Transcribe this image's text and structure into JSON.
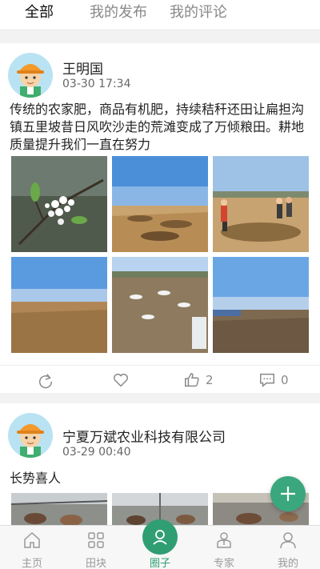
{
  "tabs": [
    {
      "label": "全部",
      "active": true
    },
    {
      "label": "我的发布",
      "active": false
    },
    {
      "label": "我的评论",
      "active": false
    }
  ],
  "posts": [
    {
      "author": "王明国",
      "time": "03-30 17:34",
      "content": "传统的农家肥，商品有机肥，持续秸秆还田让扁担沟镇五里坡昔日风吹沙走的荒滩变成了万倾粮田。耕地质量提升我们一直在努力",
      "images": [
        "pear-blossom-photo",
        "field-photo",
        "farmers-field-photo",
        "field-photo",
        "bags-field-photo",
        "field-photo"
      ],
      "likes": "2",
      "comments": "0"
    },
    {
      "author": "宁夏万斌农业科技有限公司",
      "time": "03-29 00:40",
      "content": "长势喜人",
      "images": [
        "cattle-barn-photo",
        "cattle-barn-photo",
        "cattle-barn-photo"
      ]
    }
  ],
  "nav": [
    {
      "label": "主页",
      "icon": "home-icon",
      "active": false
    },
    {
      "label": "田块",
      "icon": "grid-icon",
      "active": false
    },
    {
      "label": "圈子",
      "icon": "circle-icon",
      "active": true
    },
    {
      "label": "专家",
      "icon": "expert-icon",
      "active": false
    },
    {
      "label": "我的",
      "icon": "user-icon",
      "active": false
    }
  ],
  "colors": {
    "accent": "#2f9e73",
    "fab": "#3aa77e"
  }
}
